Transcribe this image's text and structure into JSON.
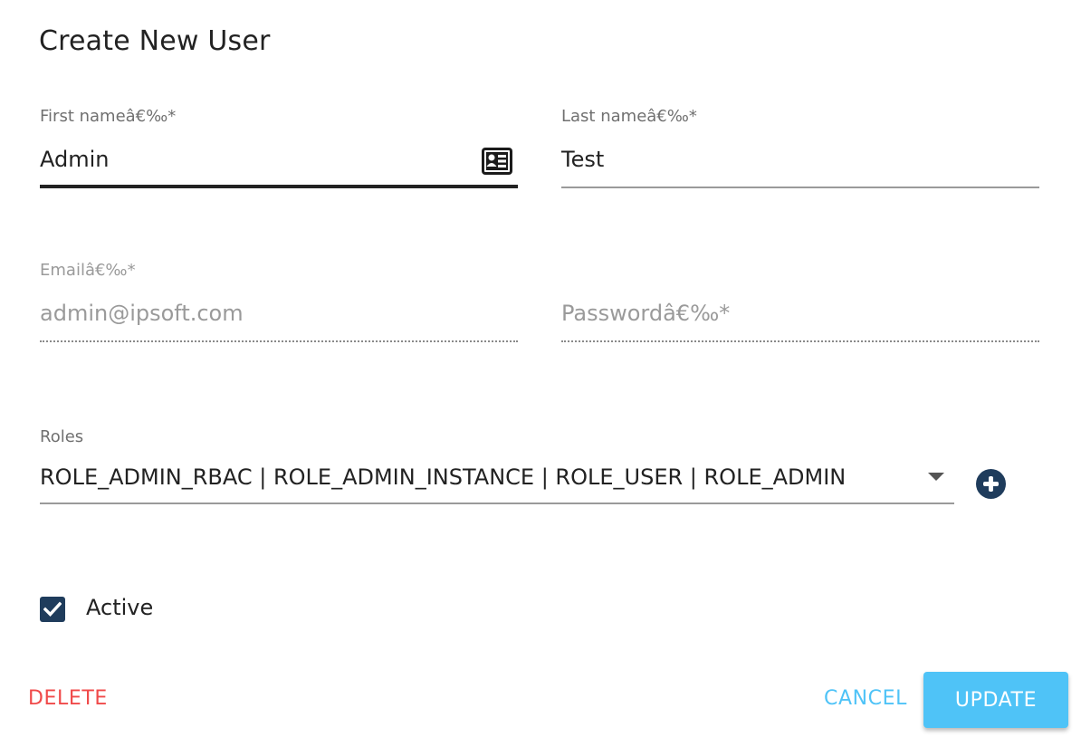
{
  "dialog": {
    "title": "Create New User"
  },
  "fields": {
    "first_name": {
      "label": "First nameâ€‰*",
      "value": "Admin"
    },
    "last_name": {
      "label": "Last nameâ€‰*",
      "value": "Test"
    },
    "email": {
      "label": "Emailâ€‰*",
      "value": "admin@ipsoft.com"
    },
    "password": {
      "placeholder": "Passwordâ€‰*"
    }
  },
  "roles": {
    "label": "Roles",
    "value": "ROLE_ADMIN_RBAC | ROLE_ADMIN_INSTANCE | ROLE_USER | ROLE_ADMIN"
  },
  "active": {
    "label": "Active",
    "checked": true
  },
  "actions": {
    "delete_label": "DELETE",
    "cancel_label": "CANCEL",
    "update_label": "UPDATE"
  },
  "icons": {
    "first_name_adornment": "id-card-icon",
    "roles_dropdown": "caret-down-icon",
    "add_role": "plus-circle-icon",
    "active_checkbox": "checkmark-icon"
  },
  "colors": {
    "delete": "#f04a4a",
    "cancel": "#4fc3f7",
    "update_bg": "#4fc3f7",
    "accent_dark": "#1f3c5c"
  }
}
